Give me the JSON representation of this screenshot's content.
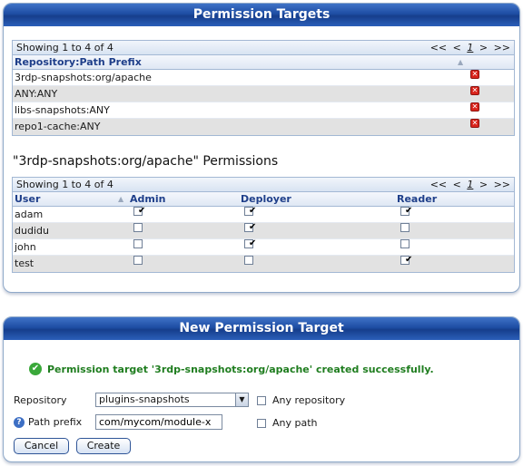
{
  "targets_panel": {
    "title": "Permission Targets",
    "pager": {
      "summary": "Showing 1 to 4 of 4",
      "first": "<<",
      "prev": "<",
      "page": "1",
      "next": ">",
      "last": ">>"
    },
    "column_header": "Repository:Path Prefix",
    "rows": [
      "3rdp-snapshots:org/apache",
      "ANY:ANY",
      "libs-snapshots:ANY",
      "repo1-cache:ANY"
    ]
  },
  "permissions": {
    "title": "\"3rdp-snapshots:org/apache\" Permissions",
    "pager": {
      "summary": "Showing 1 to 4 of 4",
      "first": "<<",
      "prev": "<",
      "page": "1",
      "next": ">",
      "last": ">>"
    },
    "columns": {
      "user": "User",
      "admin": "Admin",
      "deployer": "Deployer",
      "reader": "Reader"
    },
    "rows": [
      {
        "user": "adam",
        "admin": true,
        "deployer": true,
        "reader": true
      },
      {
        "user": "dudidu",
        "admin": false,
        "deployer": true,
        "reader": false
      },
      {
        "user": "john",
        "admin": false,
        "deployer": true,
        "reader": false
      },
      {
        "user": "test",
        "admin": false,
        "deployer": false,
        "reader": true
      }
    ]
  },
  "new_panel": {
    "title": "New Permission Target",
    "success_message": "Permission target '3rdp-snapshots:org/apache' created successfully.",
    "repository_label": "Repository",
    "repository_value": "plugins-snapshots",
    "any_repository_label": "Any repository",
    "path_prefix_label": "Path prefix",
    "path_prefix_value": "com/mycom/module-x",
    "any_path_label": "Any path",
    "cancel_label": "Cancel",
    "create_label": "Create"
  },
  "colors": {
    "header_blue": "#1e4da3",
    "success_green": "#1f7d1f",
    "delete_red": "#d9241c"
  },
  "icons": [
    "delete-icon",
    "checkmark-icon",
    "help-icon",
    "success-icon",
    "sort-arrow-icon",
    "dropdown-arrow-icon"
  ]
}
